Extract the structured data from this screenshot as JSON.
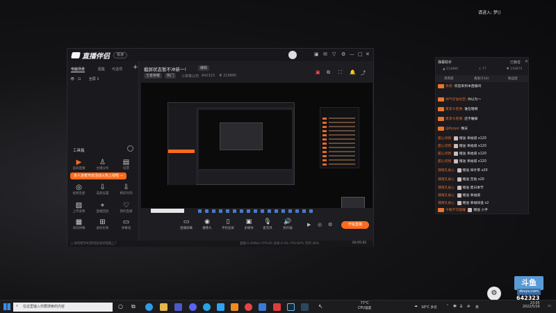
{
  "top_note": "请进入: 梦()",
  "app": {
    "logo_text": "直播伴侣",
    "version_pill": "极速",
    "titlebar_icons": [
      "avatar-icon",
      "gift-icon",
      "mail-icon",
      "filter-icon",
      "settings-icon",
      "minimize-icon",
      "maximize-icon",
      "close-icon"
    ],
    "left": {
      "tabs": [
        "电脑场景",
        "图集",
        "可选项"
      ],
      "add": "+",
      "scene_item": "全屏 1",
      "tools_title": "工具箱",
      "tools": [
        {
          "icon": "video",
          "label": "竖屏直播"
        },
        {
          "icon": "person",
          "label": "主播分析"
        },
        {
          "icon": "calendar",
          "label": "投票"
        },
        {
          "icon": "wave",
          "label": "视频连麦"
        },
        {
          "icon": "download",
          "label": "美颜设置"
        },
        {
          "icon": "download",
          "label": "精彩时刻"
        },
        {
          "icon": "image",
          "label": "上传录像"
        },
        {
          "icon": "pin",
          "label": "直播回放"
        },
        {
          "icon": "heart",
          "label": "我的直播"
        },
        {
          "icon": "grid",
          "label": "滚动弹幕"
        },
        {
          "icon": "vr",
          "label": "虚拟形象"
        },
        {
          "icon": "tv",
          "label": "弹幕墙"
        }
      ],
      "tooltip": "多人连麦开启活动火热上线啦 →"
    },
    "header": {
      "title": "截屏状态暂不冲新一!",
      "edit_tag": "编辑",
      "category_tag": "王者荣耀",
      "subcat_tag": "热门",
      "room_label": "小草莓公司",
      "room_id": "642323",
      "fans": "219895"
    },
    "header_icons": [
      "gift-icon",
      "popout-icon",
      "fullscreen-icon",
      "bell-icon",
      "share-icon"
    ],
    "controls": [
      {
        "icon": "screen",
        "label": "直播屏幕"
      },
      {
        "icon": "camera",
        "label": "摄像头"
      },
      {
        "icon": "phone",
        "label": "手机投屏"
      },
      {
        "icon": "media",
        "label": "多媒体"
      },
      {
        "icon": "mic",
        "label": "麦克风"
      },
      {
        "icon": "speaker",
        "label": "扬声器"
      }
    ],
    "go_live": "开始直播",
    "status": {
      "left": "如何把手机游戏投放到电脑上?",
      "stats": "直播 0.00Kb/s  FPS:60  丢帧:0.0%  CPU:60%  内存:40%",
      "time": "02:05:02"
    }
  },
  "right_panel": {
    "title": "弹幕助手",
    "status": "已静音",
    "stats": [
      {
        "label": "热度",
        "value": "214896"
      },
      {
        "label": "在线",
        "value": "77"
      },
      {
        "label": "粉丝",
        "value": "219875"
      }
    ],
    "tabs": [
      "贵宾席",
      "真爱(514)",
      "粉丝团"
    ],
    "messages": [
      {
        "user": "系统:",
        "text": "欢迎来到本直播间"
      },
      {
        "user": "帅气仔溢达否:",
        "text": "你以为～"
      },
      {
        "user": "夏李大老婆:",
        "text": "谁在暗啊"
      },
      {
        "user": "夏李大老婆:",
        "text": "还不睡嘛"
      },
      {
        "user": "@lfyoyo:",
        "text": "晚安"
      },
      {
        "user": "甜心问我",
        "text": "赠送 幸福袋 x120"
      },
      {
        "user": "甜心问我",
        "text": "赠送 幸福袋 x120"
      },
      {
        "user": "甜心问我",
        "text": "赠送 幸福袋 x120"
      },
      {
        "user": "甜心问我",
        "text": "赠送 幸福袋 x120"
      },
      {
        "user": "蒲南孔雀心",
        "text": "赠送 四叶草 x20"
      },
      {
        "user": "蒲南孔雀心",
        "text": "赠送 吉他 x20"
      },
      {
        "user": "蒲南孔雀心",
        "text": "赠送 夏日季节"
      },
      {
        "user": "蒲南孔雀心",
        "text": "赠送 幸福袋"
      },
      {
        "user": "蒲南孔雀心",
        "text": "赠送 幸福味道 x2"
      },
      {
        "user": "今晚不可能睡",
        "text": "赠送 小手"
      }
    ]
  },
  "douyu": {
    "logo": "斗鱼",
    "sub": "douyu.com",
    "room": "642323"
  },
  "taskbar": {
    "search_placeholder": "在这里输入你要搜索的内容",
    "cpu_temp": "77°C",
    "cpu_label": "CPU温度",
    "weather": "18°C 多云",
    "ime": "英",
    "time": "23:05",
    "date": "2022/5/19"
  }
}
